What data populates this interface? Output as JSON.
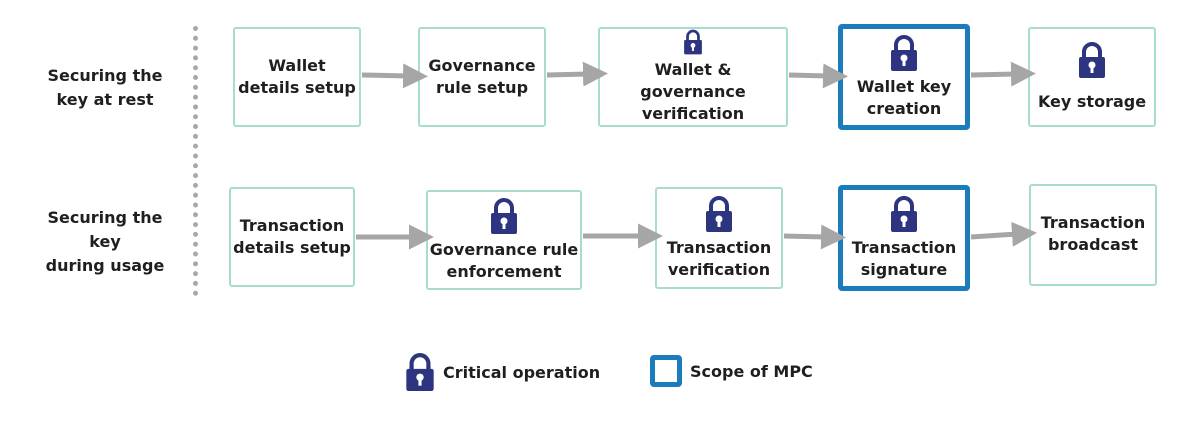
{
  "rows": [
    {
      "label": "Securing the\nkey at rest",
      "steps": [
        {
          "label": "Wallet\ndetails setup",
          "critical": false,
          "mpc": false
        },
        {
          "label": "Governance\nrule setup",
          "critical": false,
          "mpc": false
        },
        {
          "label": "Wallet & governance\nverification",
          "critical": true,
          "mpc": false
        },
        {
          "label": "Wallet key\ncreation",
          "critical": true,
          "mpc": true
        },
        {
          "label": "Key storage",
          "critical": true,
          "mpc": false
        }
      ]
    },
    {
      "label": "Securing the key\nduring usage",
      "steps": [
        {
          "label": "Transaction\ndetails setup",
          "critical": false,
          "mpc": false
        },
        {
          "label": "Governance rule\nenforcement",
          "critical": true,
          "mpc": false
        },
        {
          "label": "Transaction\nverification",
          "critical": true,
          "mpc": false
        },
        {
          "label": "Transaction\nsignature",
          "critical": true,
          "mpc": true
        },
        {
          "label": "Transaction\nbroadcast",
          "critical": false,
          "mpc": false
        }
      ]
    }
  ],
  "legend": {
    "critical_label": "Critical operation",
    "mpc_label": "Scope of MPC"
  },
  "colors": {
    "box_border": "#a7dccf",
    "mpc_border": "#1a7bbd",
    "lock": "#2e3580",
    "arrow": "#a6a6a6"
  },
  "icons": {
    "critical": "lock-icon"
  }
}
